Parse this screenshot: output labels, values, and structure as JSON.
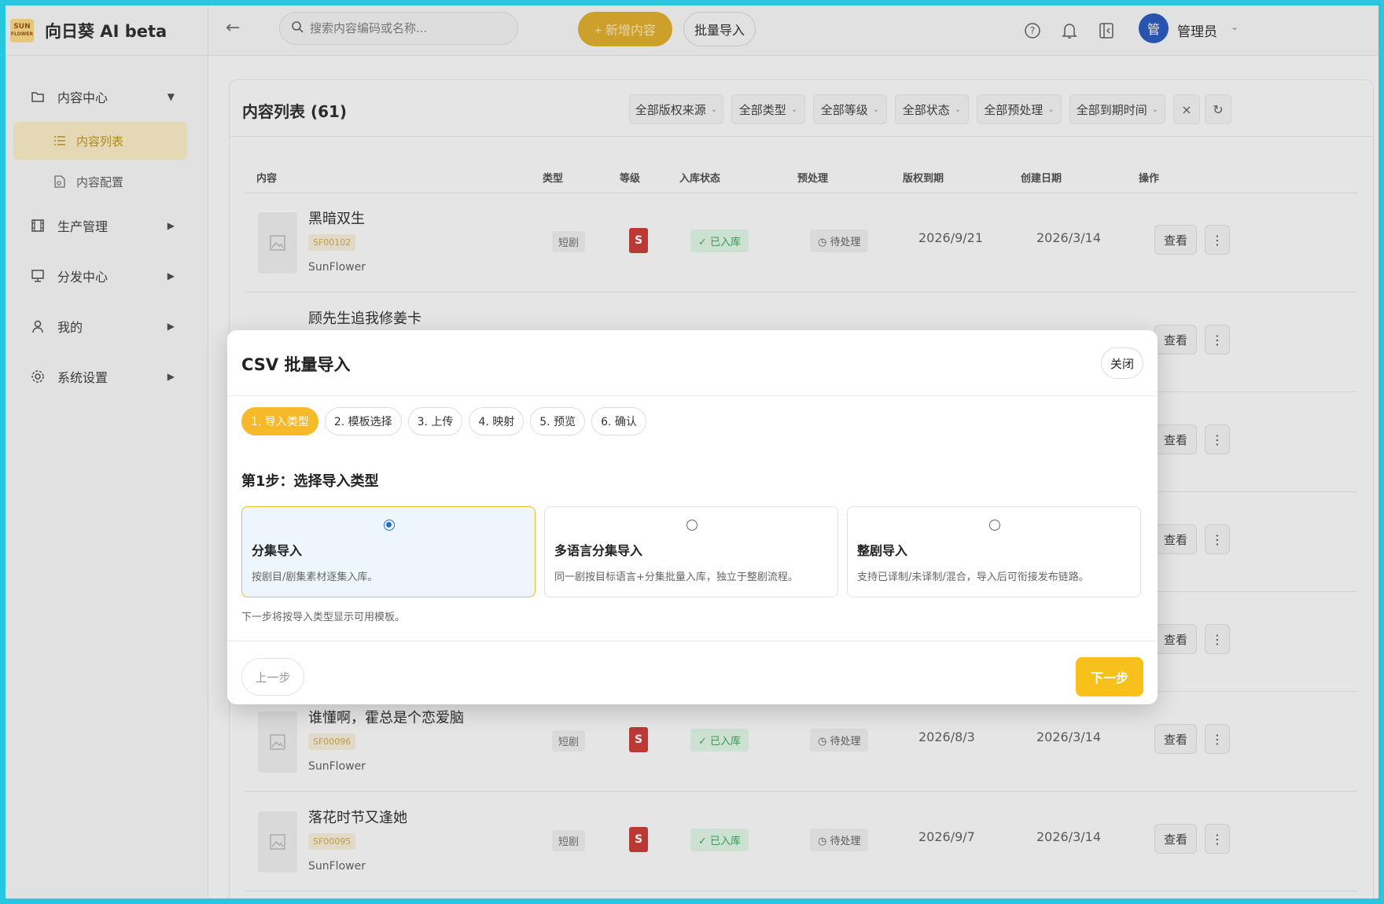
{
  "app": {
    "logo_text_top": "SUN",
    "logo_text_bottom": "FLOWER",
    "name": "向日葵 AI beta"
  },
  "sidebar": {
    "items": [
      {
        "label": "内容中心",
        "icon": "folder-icon",
        "expanded": true
      },
      {
        "label": "生产管理",
        "icon": "film-icon"
      },
      {
        "label": "分发中心",
        "icon": "monitor-icon"
      },
      {
        "label": "我的",
        "icon": "user-icon"
      },
      {
        "label": "系统设置",
        "icon": "gear-icon"
      }
    ],
    "sub_items": [
      {
        "label": "内容列表",
        "icon": "list-icon",
        "active": true
      },
      {
        "label": "内容配置",
        "icon": "file-gear-icon"
      }
    ]
  },
  "topbar": {
    "search_placeholder": "搜索内容编码或名称...",
    "new_content_label": "+ 新增内容",
    "batch_import_label": "批量导入",
    "user_avatar": "管",
    "user_name": "管理员"
  },
  "content_list": {
    "title": "内容列表 (61)",
    "filters": [
      "全部版权来源",
      "全部类型",
      "全部等级",
      "全部状态",
      "全部预处理",
      "全部到期时间"
    ],
    "columns": [
      "内容",
      "类型",
      "等级",
      "入库状态",
      "预处理",
      "版权到期",
      "创建日期",
      "操作"
    ],
    "rows": [
      {
        "title": "黑暗双生",
        "code": "SF00102",
        "org": "SunFlower",
        "type": "短剧",
        "level": "S",
        "status": "✓ 已入库",
        "pre": "◷ 待处理",
        "expire": "2026/9/21",
        "created": "2026/3/14",
        "view": "查看",
        "more": "⋮"
      },
      {
        "title": "顾先生追我修姜卡",
        "code": "",
        "org": "",
        "type": "",
        "level": "",
        "status": "",
        "pre": "",
        "expire": "",
        "created": "",
        "view": "查看",
        "more": "⋮"
      },
      {
        "title": "",
        "code": "",
        "org": "",
        "type": "",
        "level": "",
        "status": "",
        "pre": "",
        "expire": "",
        "created": "",
        "view": "查看",
        "more": "⋮"
      },
      {
        "title": "",
        "code": "",
        "org": "",
        "type": "",
        "level": "",
        "status": "",
        "pre": "",
        "expire": "",
        "created": "",
        "view": "查看",
        "more": "⋮"
      },
      {
        "title": "",
        "code": "",
        "org": "",
        "type": "",
        "level": "",
        "status": "",
        "pre": "",
        "expire": "",
        "created": "",
        "view": "查看",
        "more": "⋮"
      },
      {
        "title": "谁懂啊，霍总是个恋爱脑",
        "code": "SF00096",
        "org": "SunFlower",
        "type": "短剧",
        "level": "S",
        "status": "✓ 已入库",
        "pre": "◷ 待处理",
        "expire": "2026/8/3",
        "created": "2026/3/14",
        "view": "查看",
        "more": "⋮"
      },
      {
        "title": "落花时节又逢她",
        "code": "SF00095",
        "org": "SunFlower",
        "type": "短剧",
        "level": "S",
        "status": "✓ 已入库",
        "pre": "◷ 待处理",
        "expire": "2026/9/7",
        "created": "2026/3/14",
        "view": "查看",
        "more": "⋮"
      }
    ]
  },
  "modal": {
    "title": "CSV 批量导入",
    "close_label": "关闭",
    "steps": [
      "1. 导入类型",
      "2. 模板选择",
      "3. 上传",
      "4. 映射",
      "5. 预览",
      "6. 确认"
    ],
    "section_title": "第1步：选择导入类型",
    "options": [
      {
        "title": "分集导入",
        "desc": "按剧目/剧集素材逐集入库。",
        "selected": true
      },
      {
        "title": "多语言分集导入",
        "desc": "同一剧按目标语言+分集批量入库，独立于整剧流程。",
        "selected": false
      },
      {
        "title": "整剧导入",
        "desc": "支持已译制/未译制/混合，导入后可衔接发布链路。",
        "selected": false
      }
    ],
    "hint": "下一步将按导入类型显示可用模板。",
    "prev_label": "上一步",
    "next_label": "下一步"
  },
  "colors": {
    "accent": "#f5b92a",
    "frame": "#29c6e0",
    "level_s": "#c3302b",
    "status_ok": "#2e9c4c",
    "radio_selected": "#1a6fd6"
  }
}
